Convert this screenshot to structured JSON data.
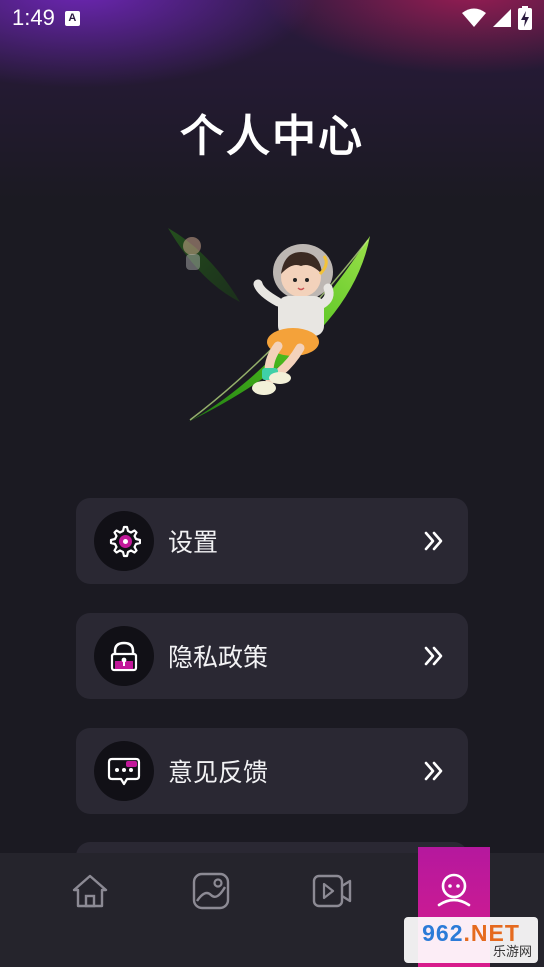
{
  "status_bar": {
    "time": "1:49",
    "notification_icon_letter": "A",
    "icons": [
      "wifi-icon",
      "signal-icon",
      "battery-charging-icon"
    ]
  },
  "page": {
    "title": "个人中心"
  },
  "menu": [
    {
      "label": "设置",
      "icon": "gear-icon"
    },
    {
      "label": "隐私政策",
      "icon": "lock-icon"
    },
    {
      "label": "意见反馈",
      "icon": "chat-bubble-icon"
    }
  ],
  "bottom_nav": {
    "items": [
      {
        "icon": "home-icon",
        "active": false
      },
      {
        "icon": "picture-icon",
        "active": false
      },
      {
        "icon": "video-icon",
        "active": false
      },
      {
        "icon": "profile-icon",
        "active": true
      }
    ]
  },
  "watermark": {
    "brand_number": "962",
    "brand_suffix": ".NET",
    "subtitle": "乐游网"
  },
  "colors": {
    "accent": "#c2189a",
    "background": "#1b1a22",
    "card": "#2a2833"
  }
}
